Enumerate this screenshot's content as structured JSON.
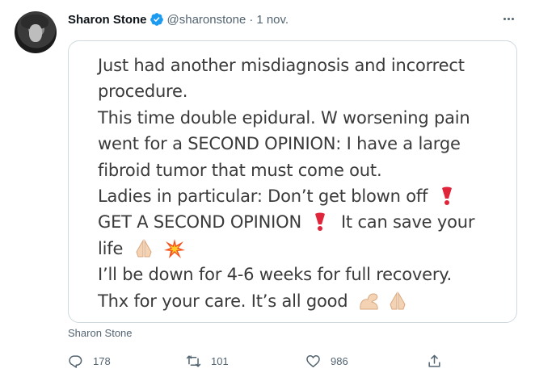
{
  "tweet": {
    "author_name": "Sharon Stone",
    "handle": "@sharonstone",
    "separator": "·",
    "date": "1 nov.",
    "verified": true
  },
  "card": {
    "lines": [
      "Just had another misdiagnosis and incorrect",
      "procedure.",
      "This time double epidural. W worsening pain",
      "went for a SECOND OPINION: I have a large",
      "fibroid tumor that must come out.",
      "Ladies in particular: Don’t get blown off",
      "GET A SECOND OPINION",
      "It can save your",
      "life",
      "I’ll be down for 4-6 weeks for full recovery.",
      "Thx for your care. It’s all good"
    ]
  },
  "source_label": "Sharon Stone",
  "actions": {
    "replies": "178",
    "retweets": "101",
    "likes": "986"
  },
  "icons": {
    "verified": "verified-badge-icon",
    "more": "more-options-icon",
    "reply": "reply-icon",
    "retweet": "retweet-icon",
    "like": "heart-icon",
    "share": "share-icon",
    "emoji_exclamation": "red-exclamation-icon",
    "emoji_pray": "folded-hands-icon",
    "emoji_collision": "collision-icon",
    "emoji_muscle": "flexed-biceps-icon"
  },
  "colors": {
    "verified_blue": "#1d9bf0",
    "secondary_text": "#536471",
    "card_border": "#cfd9de",
    "exclamation_red": "#e0243a"
  }
}
